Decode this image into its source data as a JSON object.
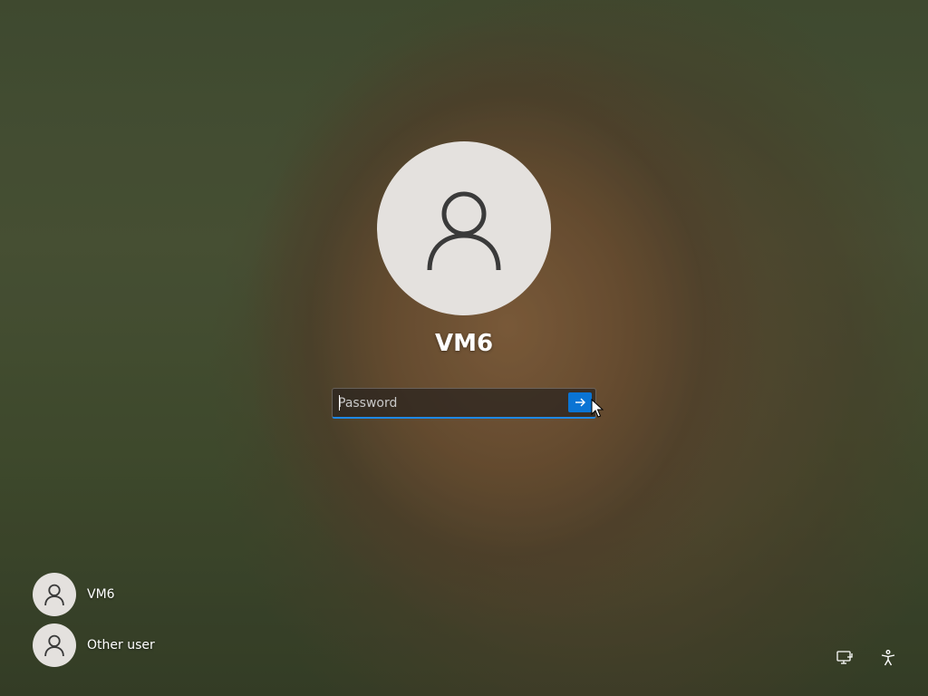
{
  "lock_screen": {
    "current_user": {
      "name": "VM6",
      "avatar_icon": "person-icon"
    },
    "password": {
      "placeholder": "Password",
      "value": "",
      "submit_icon": "arrow-right-icon"
    }
  },
  "user_list": [
    {
      "name": "VM6",
      "avatar_icon": "person-icon"
    },
    {
      "name": "Other user",
      "avatar_icon": "person-icon"
    }
  ],
  "system_buttons": {
    "network_icon": "network-icon",
    "accessibility_icon": "accessibility-icon"
  },
  "colors": {
    "accent": "#0a74d4",
    "underline": "#1e88e5",
    "avatar_bg": "#e4e1de",
    "text": "#ffffff"
  }
}
